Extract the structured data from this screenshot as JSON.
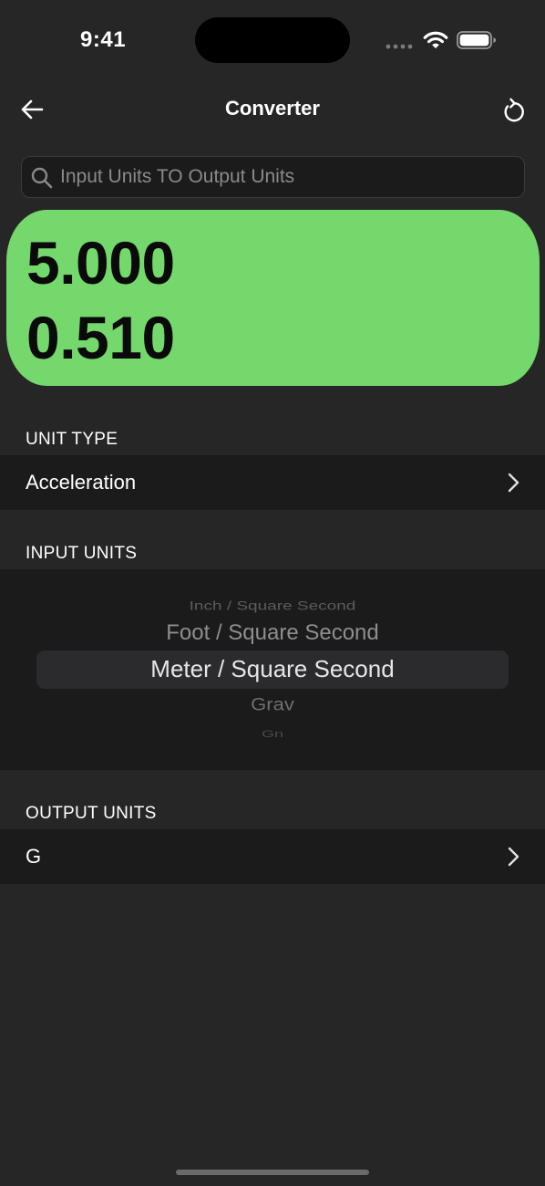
{
  "status_bar": {
    "time": "9:41"
  },
  "nav": {
    "title": "Converter"
  },
  "search": {
    "placeholder": "Input Units TO Output Units",
    "value": ""
  },
  "result": {
    "input_value": "5.000",
    "output_value": "0.510",
    "color": "#74d86c"
  },
  "unit_type": {
    "section_label": "UNIT TYPE",
    "value": "Acceleration"
  },
  "input_units": {
    "section_label": "INPUT UNITS",
    "options": [
      "Inch / Square Second",
      "Foot / Square Second",
      "Meter / Square Second",
      "Grav",
      "Gn"
    ],
    "selected": "Meter / Square Second"
  },
  "output_units": {
    "section_label": "OUTPUT UNITS",
    "value": "G"
  },
  "icons": {
    "back": "arrow-left-icon",
    "reset": "rotate-ccw-icon",
    "search": "magnifier-icon",
    "chevron": "chevron-right-icon"
  }
}
